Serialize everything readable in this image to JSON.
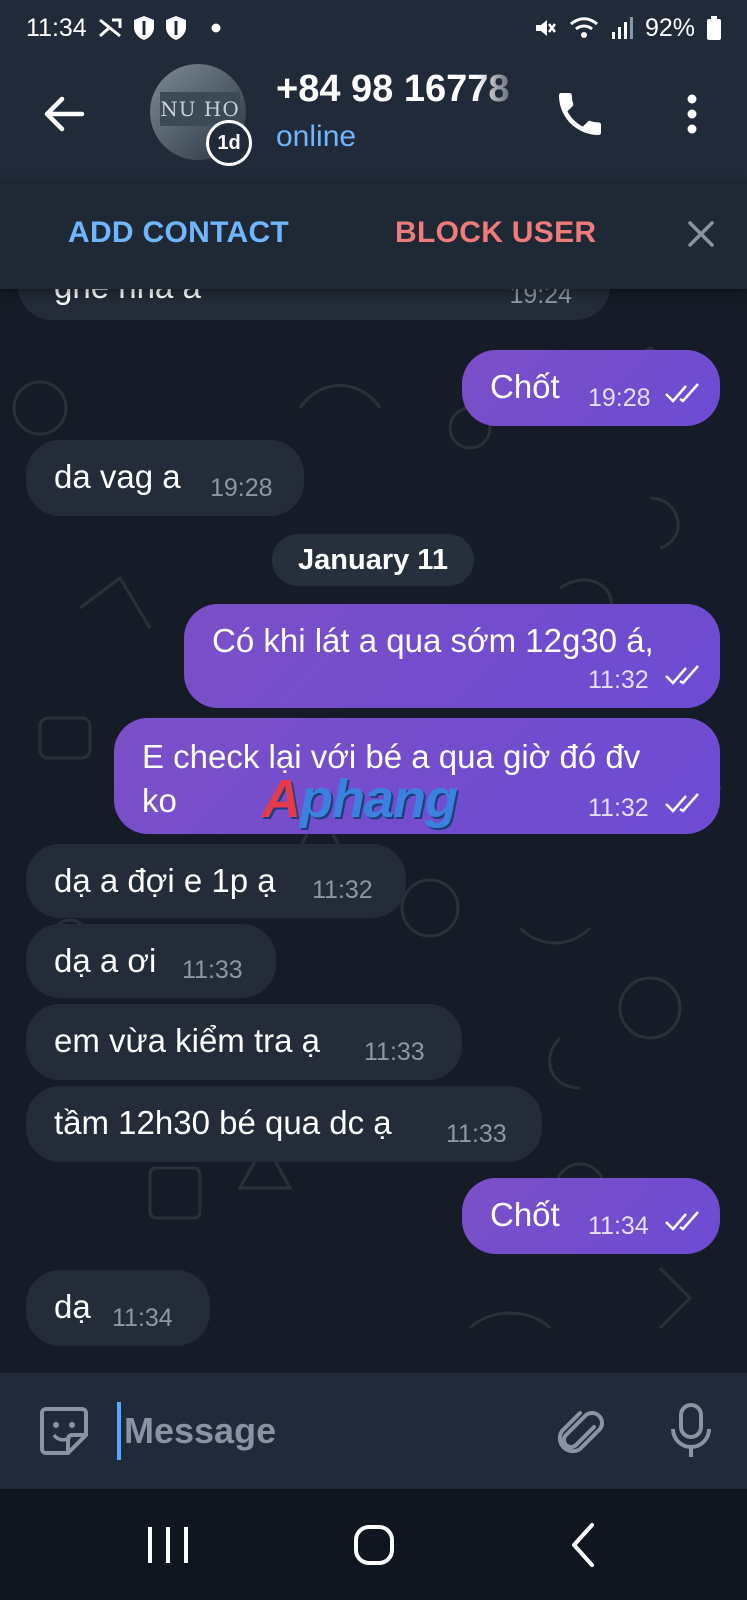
{
  "status_bar": {
    "time": "11:34",
    "battery": "92%",
    "icons_left": [
      "missed-call-icon",
      "shield-icon",
      "shield-icon",
      "dot-icon"
    ],
    "icons_right": [
      "mute-icon",
      "wifi-icon",
      "signal-icon",
      "battery-icon"
    ]
  },
  "header": {
    "contact_name": "+84 98 16778",
    "status": "online",
    "story_badge": "1d",
    "avatar_text": "NU HO"
  },
  "action_bar": {
    "add_contact": "ADD CONTACT",
    "block_user": "BLOCK USER"
  },
  "messages": [
    {
      "direction": "in",
      "text": "gne nna a",
      "time": "19:24"
    },
    {
      "direction": "out",
      "text": "Chốt",
      "time": "19:28",
      "read": true
    },
    {
      "direction": "in",
      "text": "da vag a",
      "time": "19:28"
    },
    {
      "direction": "out",
      "text": "Có khi lát a qua sớm 12g30 á,",
      "time": "11:32",
      "read": true
    },
    {
      "direction": "out",
      "text_line1": "E check lại với bé a qua giờ đó đv",
      "text_line2": "ko",
      "time": "11:32",
      "read": true
    },
    {
      "direction": "in",
      "text": "dạ a đợi e 1p ạ",
      "time": "11:32"
    },
    {
      "direction": "in",
      "text": "dạ a ơi",
      "time": "11:33"
    },
    {
      "direction": "in",
      "text": "em vừa kiểm tra ạ",
      "time": "11:33"
    },
    {
      "direction": "in",
      "text": "tầm 12h30 bé qua dc ạ",
      "time": "11:33"
    },
    {
      "direction": "out",
      "text": "Chốt",
      "time": "11:34",
      "read": true
    },
    {
      "direction": "in",
      "text": "dạ",
      "time": "11:34"
    }
  ],
  "date_separator": "January 11",
  "watermark": {
    "first": "A",
    "rest": "phang"
  },
  "composer": {
    "placeholder": "Message"
  },
  "colors": {
    "accent": "#6fb6ff",
    "danger": "#f07b7b",
    "outgoing_bubble": "#7350cd",
    "incoming_bubble": "#232c38"
  }
}
